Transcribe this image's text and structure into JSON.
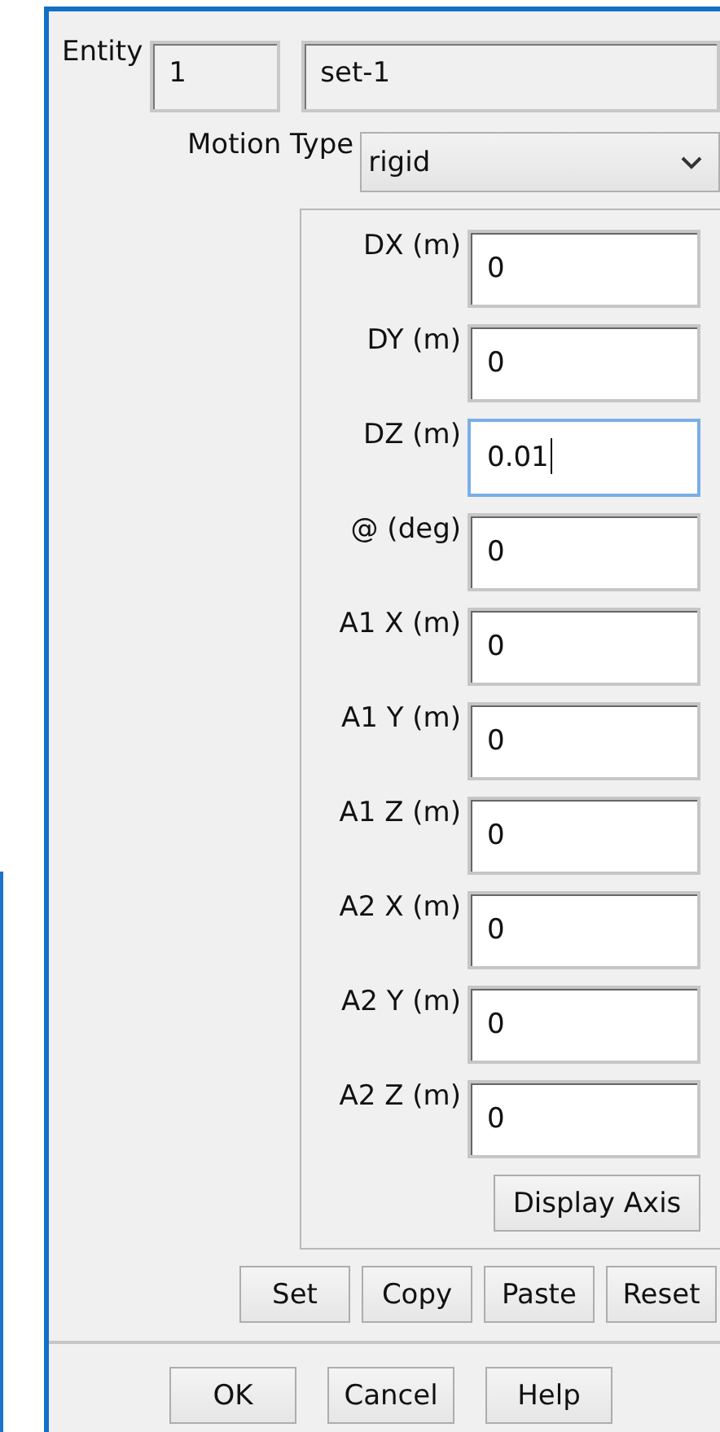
{
  "entity": {
    "label": "Entity",
    "number": "1",
    "name": "set-1"
  },
  "motion_type": {
    "label": "Motion Type",
    "value": "rigid"
  },
  "fields": [
    {
      "label": "DX (m)",
      "value": "0",
      "focused": false
    },
    {
      "label": "DY (m)",
      "value": "0",
      "focused": false
    },
    {
      "label": "DZ (m)",
      "value": "0.01",
      "focused": true
    },
    {
      "label": "@ (deg)",
      "value": "0",
      "focused": false
    },
    {
      "label": "A1 X (m)",
      "value": "0",
      "focused": false
    },
    {
      "label": "A1 Y (m)",
      "value": "0",
      "focused": false
    },
    {
      "label": "A1 Z (m)",
      "value": "0",
      "focused": false
    },
    {
      "label": "A2 X (m)",
      "value": "0",
      "focused": false
    },
    {
      "label": "A2 Y (m)",
      "value": "0",
      "focused": false
    },
    {
      "label": "A2 Z (m)",
      "value": "0",
      "focused": false
    }
  ],
  "panel_button": "Display Axis",
  "edit_buttons": [
    "Set",
    "Copy",
    "Paste",
    "Reset"
  ],
  "dialog_buttons": [
    "OK",
    "Cancel",
    "Help"
  ]
}
